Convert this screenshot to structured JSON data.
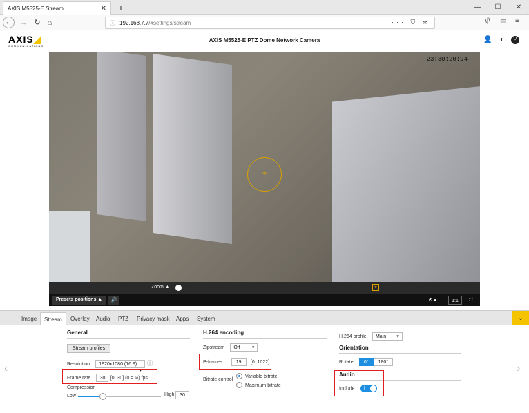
{
  "browser": {
    "tab_title": "AXIS M5525-E Stream",
    "tab_close": "✕",
    "new_tab": "+",
    "url_host": "192.168.7.7",
    "url_path": "/#settings/stream",
    "url_icons": "··· ⛉ ☆",
    "window_buttons": [
      "—",
      "☐",
      "✕"
    ],
    "nav_right_icons": [
      "\\|\\",
      "▭",
      "≡"
    ]
  },
  "app": {
    "logo": "AXIS",
    "logo_tag": "COMMUNICATIONS",
    "title": "AXIS M5525-E PTZ Dome Network Camera"
  },
  "video": {
    "timestamp": "23:30:20:94",
    "zoom_label": "Zoom ▲",
    "zoom_level": 0.0,
    "preset_button": "Presets positions ▲",
    "ratio_button": "1:1"
  },
  "settings": {
    "tabs": [
      "Image",
      "Stream",
      "Overlay",
      "Audio",
      "PTZ",
      "Privacy mask",
      "Apps",
      "System"
    ],
    "active_tab": "Stream",
    "general": {
      "heading": "General",
      "stream_profiles_button": "Stream profiles",
      "resolution_label": "Resolution",
      "resolution_value": "1920x1080 (16:9)",
      "frame_rate_label": "Frame rate",
      "frame_rate_value": "30",
      "frame_rate_hint": "[0..30] (0 = ∞) fps",
      "compression_label": "Compression",
      "compression_low": "Low",
      "compression_high": "High",
      "compression_value": "30"
    },
    "h264": {
      "heading": "H.264 encoding",
      "zipstream_label": "Zipstream",
      "zipstream_value": "Off",
      "pframes_label": "P-frames",
      "pframes_value": "19",
      "pframes_hint": "[0..1022]",
      "bitrate_label": "Bitrate control",
      "bitrate_options": [
        "Variable bitrate",
        "Maximum bitrate"
      ],
      "bitrate_selected": "Variable bitrate"
    },
    "right": {
      "profile_label": "H.264 profile",
      "profile_value": "Main",
      "orientation_heading": "Orientation",
      "rotate_label": "Rotate",
      "rotate_options": [
        "0°",
        "180°"
      ],
      "rotate_selected": "0°",
      "audio_heading": "Audio",
      "include_label": "Include",
      "include_on": true
    }
  },
  "colors": {
    "accent": "#1e8fe0",
    "brand_yellow": "#f5c400",
    "highlight_red": "#e02020"
  }
}
